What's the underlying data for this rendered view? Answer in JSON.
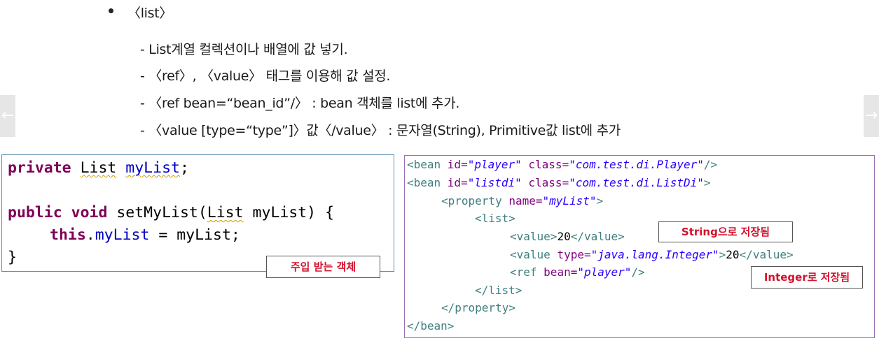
{
  "bullets": {
    "title": "〈list〉",
    "items": [
      "- List계열 컬렉션이나 배열에 값 넣기.",
      "- 〈ref〉, 〈value〉 태그를 이용해 값 설정.",
      "- 〈ref bean=“bean_id”/〉 : bean 객체를 list에 추가.",
      "- 〈value [type=“type”]〉값〈/value〉 : 문자열(String), Primitive값 list에 추가"
    ]
  },
  "nav": {
    "prev_icon": "←",
    "next_icon": "→"
  },
  "java_code": {
    "kw_private": "private",
    "type_list": "List",
    "var_mylist": "myList",
    "semicolon": ";",
    "kw_public": "public",
    "kw_void": "void",
    "method_open": " setMyList(",
    "param_type": "List",
    "param_rest": " myList) {",
    "kw_this": "this",
    "assign_field": "myList",
    "assign_rest": " = myList;",
    "close_brace": "}"
  },
  "xml_code": {
    "l1_tag": "<bean ",
    "l1_id": "id=",
    "l1_id_val": "\"player\"",
    "l1_class": " class=",
    "l1_class_val": "\"com.test.di.Player\"",
    "l1_end": "/>",
    "l2_tag": "<bean ",
    "l2_id": "id=",
    "l2_id_val": "\"listdi\"",
    "l2_class": " class=",
    "l2_class_val": "\"com.test.di.ListDi\"",
    "l2_end": ">",
    "l3_tag": "<property ",
    "l3_name": "name=",
    "l3_name_val": "\"myList\"",
    "l3_end": ">",
    "l4": "<list>",
    "l5_open": "<value>",
    "l5_val": "20",
    "l5_close": "</value>",
    "l6_tag": "<value ",
    "l6_type": "type=",
    "l6_type_val": "\"java.lang.Integer\"",
    "l6_gt": ">",
    "l6_val": "20",
    "l6_close": "</value>",
    "l7_tag": "<ref ",
    "l7_bean": "bean=",
    "l7_bean_val": "\"player\"",
    "l7_end": "/>",
    "l8": "</list>",
    "l9": "</property>",
    "l10": "</bean>"
  },
  "callouts": {
    "injected": "주입 받는 객체",
    "string_saved": "String으로 저장됨",
    "integer_saved": "Integer로 저장됨"
  },
  "colors": {
    "keyword": "#7f0055",
    "field": "#0000c0",
    "xml_tag": "#3f7f7f",
    "xml_attr": "#7f007f",
    "xml_value": "#2a00ff",
    "callout_text": "#d3122e"
  }
}
